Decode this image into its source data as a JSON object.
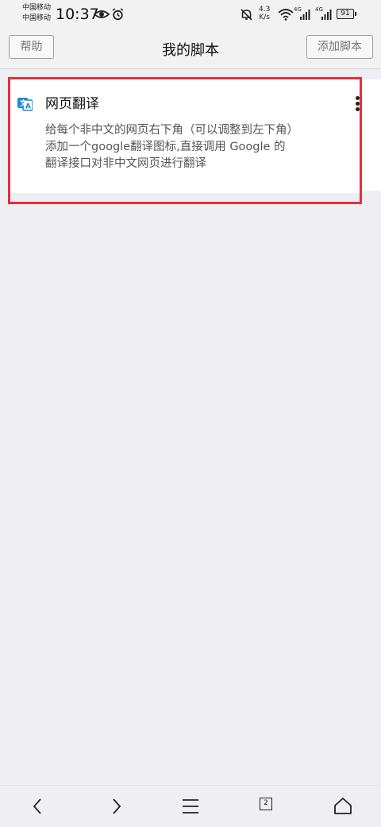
{
  "status_bar": {
    "carrier_1": "中国移动",
    "carrier_2": "中国移动",
    "time": "10:37",
    "net_speed_value": "4.3",
    "net_speed_unit": "K/s",
    "net_type_1": "4G",
    "net_type_2": "4G",
    "battery": "91",
    "icons": [
      "eye-icon",
      "alarm-icon",
      "mute-bell-icon",
      "wifi-icon",
      "signal-icon",
      "signal-icon",
      "battery-icon"
    ]
  },
  "header": {
    "help_label": "帮助",
    "title": "我的脚本",
    "add_label": "添加脚本"
  },
  "scripts": [
    {
      "title": "网页翻译",
      "icon": "translate-icon",
      "description_line_1": "给每个非中文的网页右下角（可以调整到左下角）",
      "description_line_2": "添加一个google翻译图标,直接调用 Google 的",
      "description_line_3": "翻译接口对非中文网页进行翻译"
    }
  ],
  "navbar": {
    "tab_count": "2",
    "items": [
      "back-icon",
      "forward-icon",
      "menu-icon",
      "tabs-icon",
      "home-icon"
    ]
  },
  "colors": {
    "highlight_border": "#e0313b",
    "background": "#efeef3",
    "translate_icon": "#1a8ad4"
  }
}
